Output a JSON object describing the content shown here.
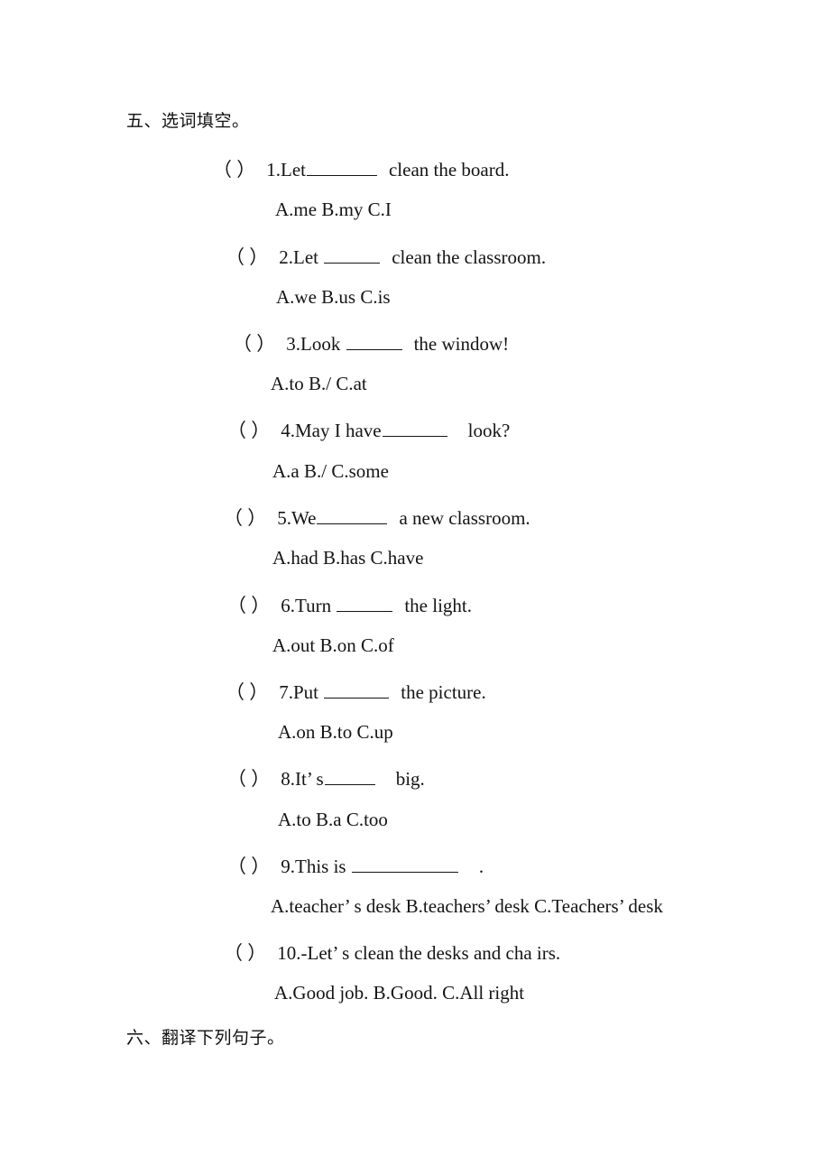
{
  "page": {
    "background_color": "#ffffff",
    "text_color": "#141414"
  },
  "sections": [
    {
      "number": "五、",
      "title": "选词填空。",
      "full": "五、选词填空。"
    },
    {
      "number": "六、",
      "title": "翻译下列句子。",
      "full": "六、翻译下列句子。"
    }
  ],
  "questions": [
    {
      "marker": "（ ）",
      "number": "1.",
      "stem_before": "Let",
      "stem_after": "clean the board.",
      "blank_width": 78,
      "options": "A.me    B.my    C.I"
    },
    {
      "marker": "（ ）",
      "number": "2.",
      "stem_before": "Let ",
      "stem_after": "clean the classroom.",
      "blank_width": 62,
      "options": "A.we   B.us   C.is"
    },
    {
      "marker": "（ ）",
      "number": "3.",
      "stem_before": "Look ",
      "stem_after": "the window!",
      "blank_width": 62,
      "options": "A.to    B./   C.at"
    },
    {
      "marker": "（ ）",
      "number": "4.",
      "stem_before": "May I have",
      "stem_after": "look?",
      "blank_width": 72,
      "options": "A.a   B./    C.some"
    },
    {
      "marker": "（ ）",
      "number": "5.",
      "stem_before": "We",
      "stem_after": "a new classroom.",
      "blank_width": 78,
      "options": "A.had  B.has   C.have"
    },
    {
      "marker": "（ ）",
      "number": "6.",
      "stem_before": "Turn ",
      "stem_after": "the  light.",
      "blank_width": 62,
      "options": "A.out   B.on   C.of"
    },
    {
      "marker": "（ ）",
      "number": "7.",
      "stem_before": "Put ",
      "stem_after": "the picture.",
      "blank_width": 72,
      "options": "A.on   B.to    C.up"
    },
    {
      "marker": "（ ）",
      "number": "8.",
      "stem_before": "It’ s",
      "stem_after": "big.",
      "blank_width": 56,
      "options": "A.to   B.a   C.too"
    },
    {
      "marker": "（ ）",
      "number": "9.",
      "stem_before": "This is ",
      "stem_after": ".",
      "blank_width": 118,
      "options": "A.teacher’ s desk   B.teachers’ desk   C.Teachers’ desk"
    },
    {
      "marker": "（ ）",
      "number": "10.",
      "stem_before": "-Let’ s clean the desks and cha irs.",
      "stem_after": "",
      "blank_width": 0,
      "options": "A.Good job.   B.Good.    C.All right"
    }
  ]
}
